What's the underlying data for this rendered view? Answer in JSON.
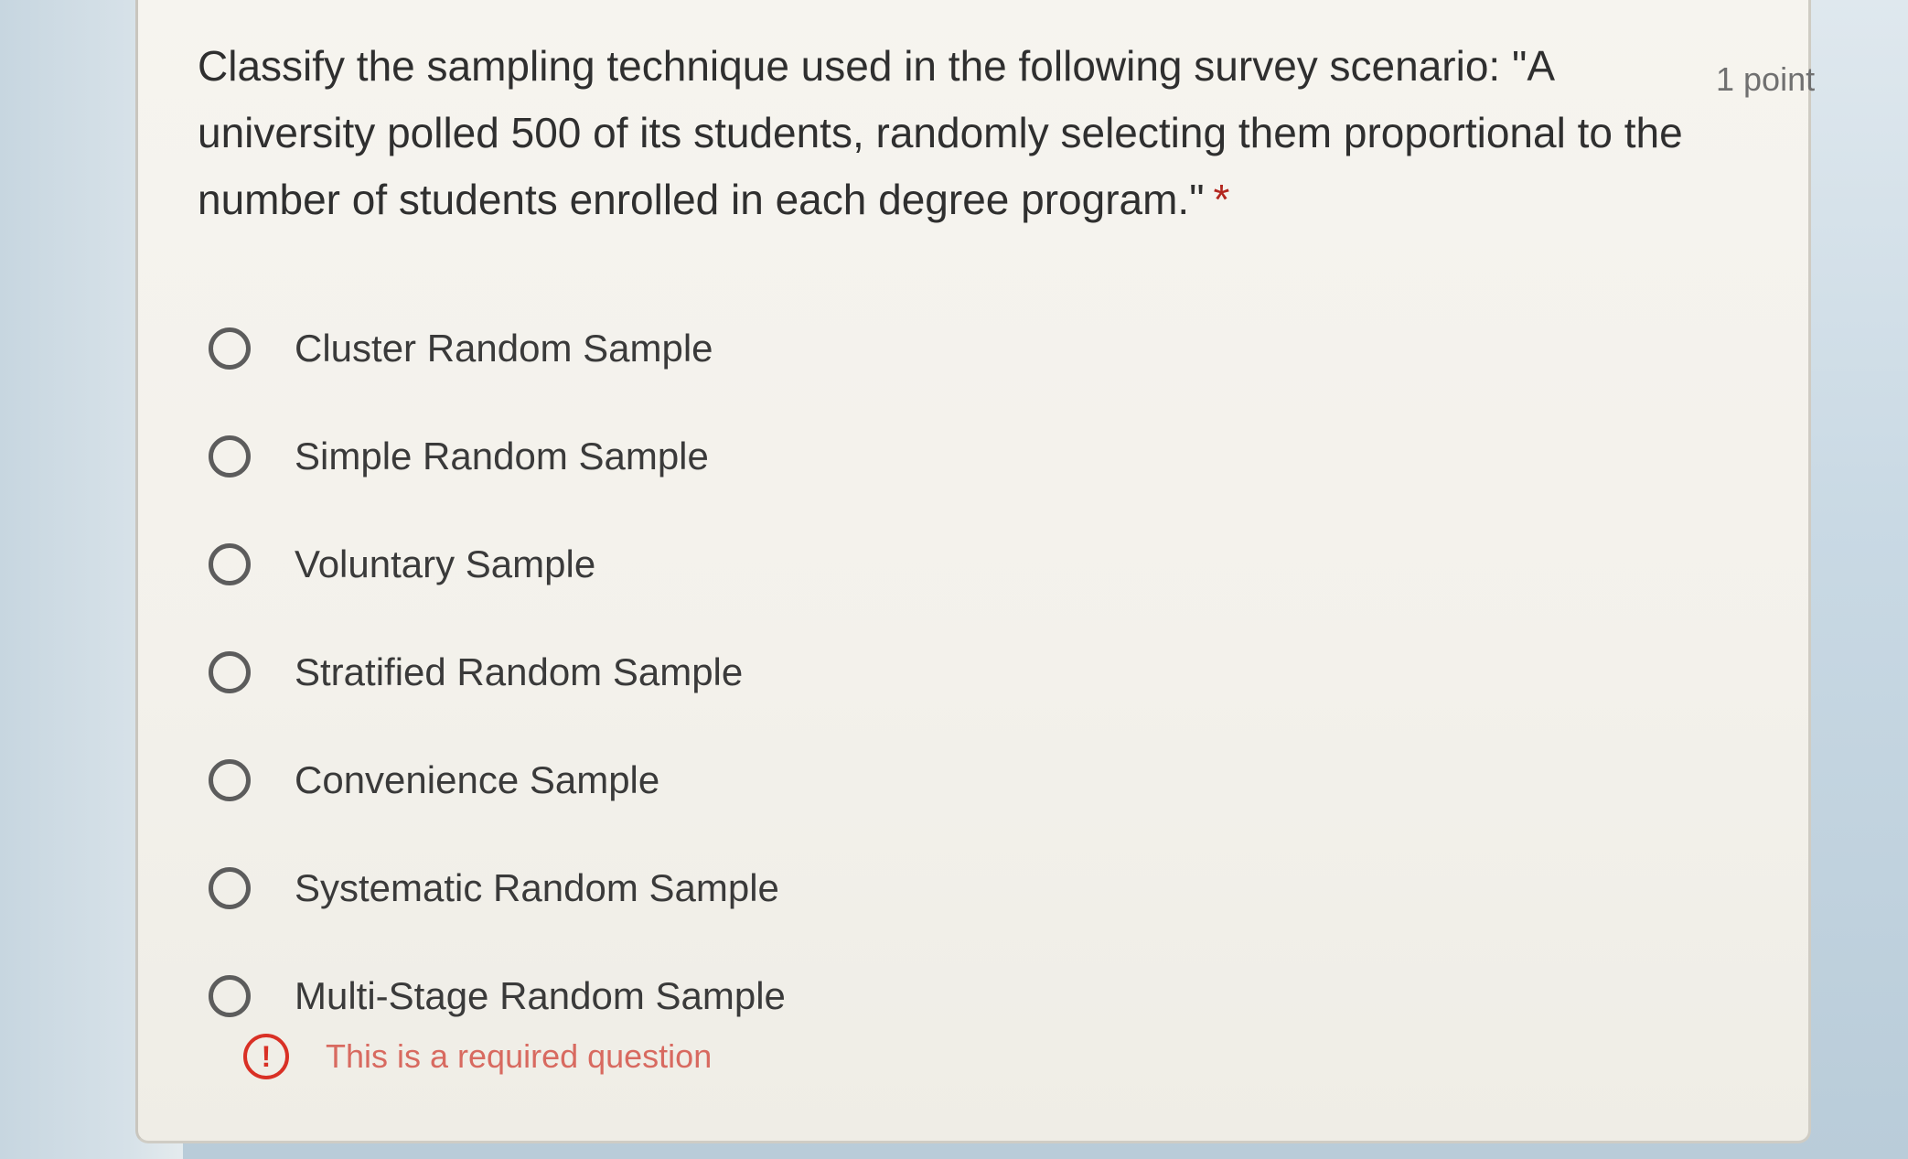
{
  "question": {
    "text": "Classify the sampling technique used in the following survey scenario: \"A university polled 500 of its students, randomly selecting them proportional to the number of students enrolled in each degree program.\"",
    "required_marker": "*",
    "points": "1 point"
  },
  "options": [
    {
      "label": "Cluster Random Sample",
      "selected": false
    },
    {
      "label": "Simple Random Sample",
      "selected": false
    },
    {
      "label": "Voluntary Sample",
      "selected": false
    },
    {
      "label": "Stratified Random Sample",
      "selected": false
    },
    {
      "label": "Convenience Sample",
      "selected": false
    },
    {
      "label": "Systematic Random Sample",
      "selected": false
    },
    {
      "label": "Multi-Stage Random Sample",
      "selected": false
    }
  ],
  "validation": {
    "icon": "exclamation-icon",
    "message": "This is a required question"
  },
  "colors": {
    "error": "#d93025",
    "required_star": "#b3261e",
    "card_background": "#f4f2ec"
  }
}
